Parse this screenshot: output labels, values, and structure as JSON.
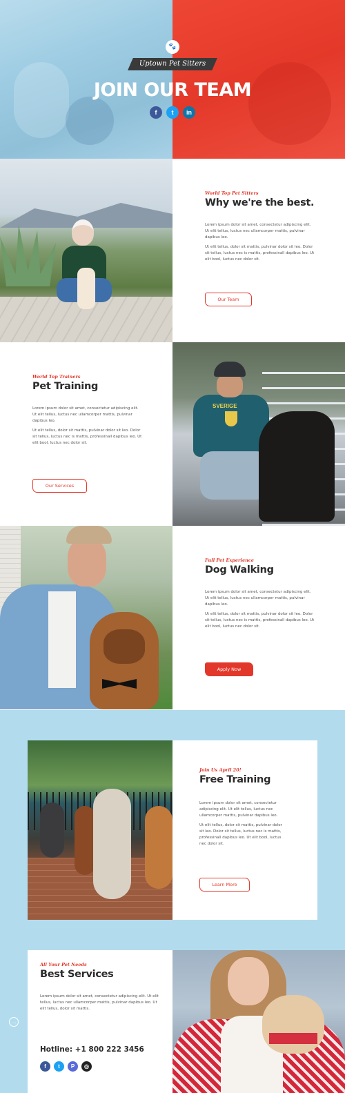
{
  "hero": {
    "brand": "Uptown Pet Sitters",
    "title": "JOIN OUR TEAM",
    "social": [
      {
        "icon": "facebook-icon",
        "glyph": "f",
        "color": "#3b5998"
      },
      {
        "icon": "twitter-icon",
        "glyph": "t",
        "color": "#1da1f2"
      },
      {
        "icon": "linkedin-icon",
        "glyph": "in",
        "color": "#0e76a8"
      }
    ],
    "left_color": "#a7d1e6",
    "right_color": "#e4392a"
  },
  "sections": [
    {
      "kicker": "World Top Pet Sitters",
      "heading": "Why we're the best.",
      "para1": "Lorem ipsum dolor sit amet, consectetur adipiscing elit. Ut elit tellus, luctus nec ullamcorper mattis, pulvinar dapibus leo.",
      "para2": "Ut elit tellus, dolor sit mattis, pulvinar dolor sit leo. Dolor sit tellus, luctus nec is mattis, professinall dapibus leo. Ut elit bool, luctus nec dolor sit.",
      "button": "Our Team"
    },
    {
      "kicker": "World Top Trainers",
      "heading": "Pet Training",
      "para1": "Lorem ipsum dolor sit amet, consectetur adipiscing elit. Ut elit tellus, luctus nec ullamcorper mattis, pulvinar dapibus leo.",
      "para2": "Ut elit tellus, dolor sit mattis, pulvinar dolor sit leo. Dolor sit tellus, luctus nec is mattis, professinall dapibus leo. Ut elit bool, luctus nec dolor sit.",
      "button": "Our Services"
    },
    {
      "kicker": "Full Pet Experience",
      "heading": "Dog Walking",
      "para1": "Lorem ipsum dolor sit amet, consectetur adipiscing elit. Ut elit tellus, luctus nec ullamcorper mattis, pulvinar dapibus leo.",
      "para2": "Ut elit tellus, dolor sit mattis, pulvinar dolor sit leo. Dolor sit tellus, luctus nec is mattis, professinall dapibus leo. Ut elit bool, luctus nec dolor sit.",
      "button": "Apply Now"
    }
  ],
  "training": {
    "kicker": "Join Us April 20!",
    "heading": "Free Training",
    "para1": "Lorem ipsum dolor sit amet, consectetur adipiscing elit. Ut elit tellus, luctus nec ullamcorper mattis, pulvinar dapibus leo.",
    "para2": "Ut elit tellus, dolor sit mattis, pulvinar dolor sit leo. Dolor sit tellus, luctus nec is mattis, professinall dapibus leo. Ut elit bool, luctus nec dolor sit.",
    "button": "Learn More"
  },
  "services": {
    "kicker": "All Your Pet Needs",
    "heading": "Best Services",
    "para": "Lorem ipsum dolor sit amet, consectetur adipiscing elit. Ut elit tellus, luctus nec ullamcorper mattis, pulvinar dapibus leo. Ut elit tellus, dolor sit mattis.",
    "hotline": "Hotline: +1 800 222 3456",
    "social": [
      {
        "icon": "facebook-icon",
        "glyph": "f",
        "color": "#3b5998"
      },
      {
        "icon": "twitter-icon",
        "glyph": "t",
        "color": "#1da1f2"
      },
      {
        "icon": "foursquare-icon",
        "glyph": "P",
        "color": "#5a6ad8"
      },
      {
        "icon": "instagram-icon",
        "glyph": "◎",
        "color": "#222222"
      }
    ]
  },
  "colors": {
    "accent": "#e2382b",
    "band": "#b2dcee",
    "heading": "#2b2b2b"
  },
  "chat_icon": "chat-icon"
}
